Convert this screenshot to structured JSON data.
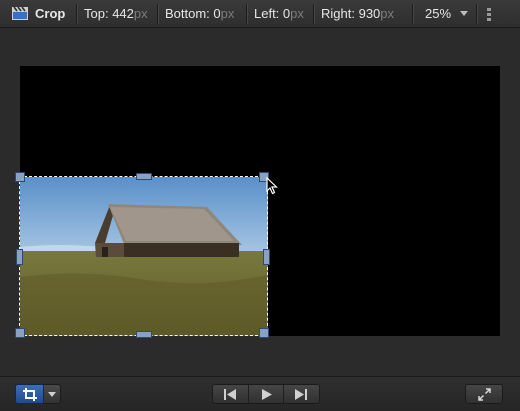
{
  "toolbar": {
    "tool_name": "Crop",
    "fields": [
      {
        "label": "Top:",
        "value": "442",
        "unit": "px"
      },
      {
        "label": "Bottom:",
        "value": "0",
        "unit": "px"
      },
      {
        "label": "Left:",
        "value": "0",
        "unit": "px"
      },
      {
        "label": "Right:",
        "value": "930",
        "unit": "px"
      }
    ],
    "zoom": "25%",
    "icons": {
      "clapper": "clapperboard-icon",
      "zoom_menu": "chevron-down-icon",
      "options": "grip-icon"
    }
  },
  "viewer": {
    "image_subject": "old wooden barn in grassy field under blue sky",
    "crop_handles": [
      "top-left",
      "top-center",
      "top-right",
      "middle-left",
      "middle-right",
      "bottom-left",
      "bottom-center",
      "bottom-right"
    ]
  },
  "bottombar": {
    "icons": {
      "crop_tool": "crop-icon",
      "tool_menu": "chevron-down-icon",
      "previous": "skip-back-icon",
      "play": "play-icon",
      "next": "skip-forward-icon",
      "fullscreen": "expand-icon"
    },
    "colors": {
      "active_tool": "#2f5ca6"
    }
  }
}
